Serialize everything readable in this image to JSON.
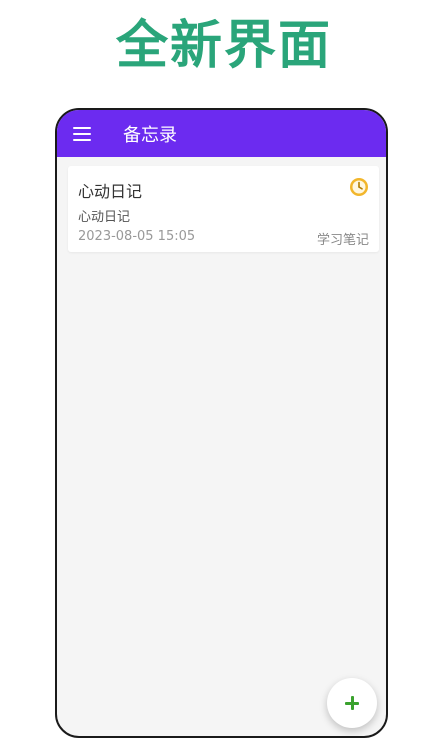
{
  "promo": {
    "title": "全新界面"
  },
  "app_bar": {
    "title": "备忘录",
    "menu_icon": "hamburger-menu-icon",
    "background_color": "#6c2bf0"
  },
  "notes": [
    {
      "title": "心动日记",
      "content": "心动日记",
      "time": "2023-08-05 15:05",
      "category": "学习笔记",
      "icon": "clock-icon"
    }
  ],
  "fab": {
    "icon": "plus-icon",
    "color": "#3aa22e"
  },
  "colors": {
    "promo_green": "#2aa57a",
    "screen_background": "#f5f5f5",
    "clock_fill": "#f2b62b"
  }
}
